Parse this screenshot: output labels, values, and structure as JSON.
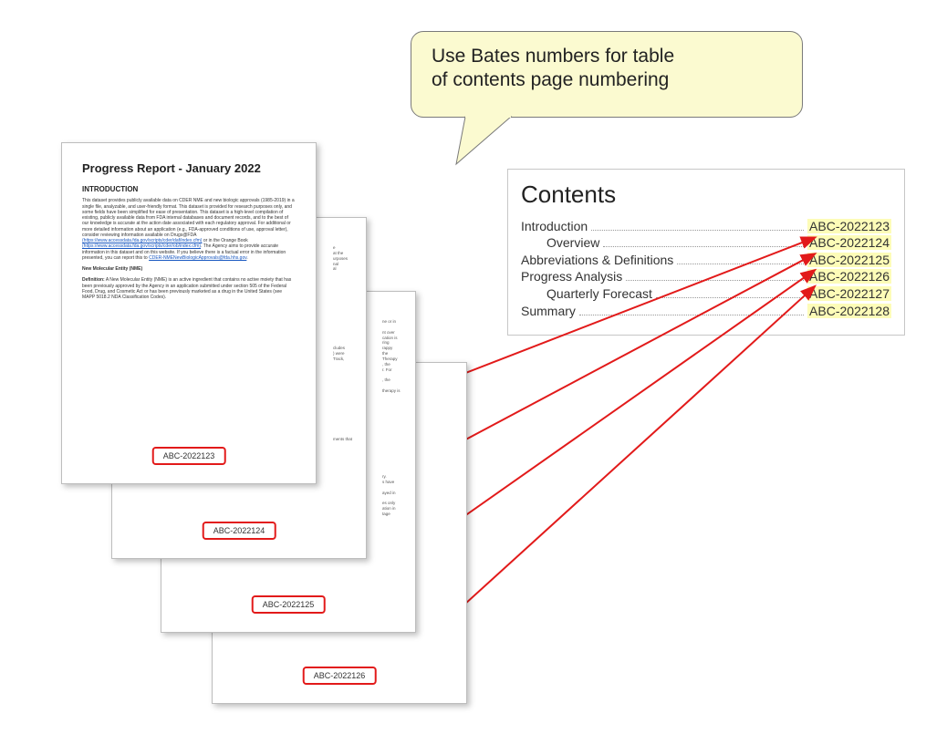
{
  "callout": {
    "line1": "Use Bates numbers for table",
    "line2": "of contents page numbering"
  },
  "contents": {
    "heading": "Contents",
    "items": [
      {
        "label": "Introduction",
        "page": "ABC-2022123",
        "indent": false
      },
      {
        "label": "Overview",
        "page": "ABC-2022124",
        "indent": true
      },
      {
        "label": "Abbreviations & Definitions",
        "page": "ABC-2022125",
        "indent": false
      },
      {
        "label": "Progress Analysis",
        "page": "ABC-2022126",
        "indent": false
      },
      {
        "label": "Quarterly Forecast",
        "page": "ABC-2022127",
        "indent": true
      },
      {
        "label": "Summary",
        "page": "ABC-2022128",
        "indent": false
      }
    ]
  },
  "pages": [
    {
      "bates": "ABC-2022123"
    },
    {
      "bates": "ABC-2022124"
    },
    {
      "bates": "ABC-2022125"
    },
    {
      "bates": "ABC-2022126"
    }
  ],
  "doc": {
    "title": "Progress Report - January 2022",
    "introHeading": "INTRODUCTION",
    "nmeHeading": "New Molecular Entity (NME)"
  }
}
